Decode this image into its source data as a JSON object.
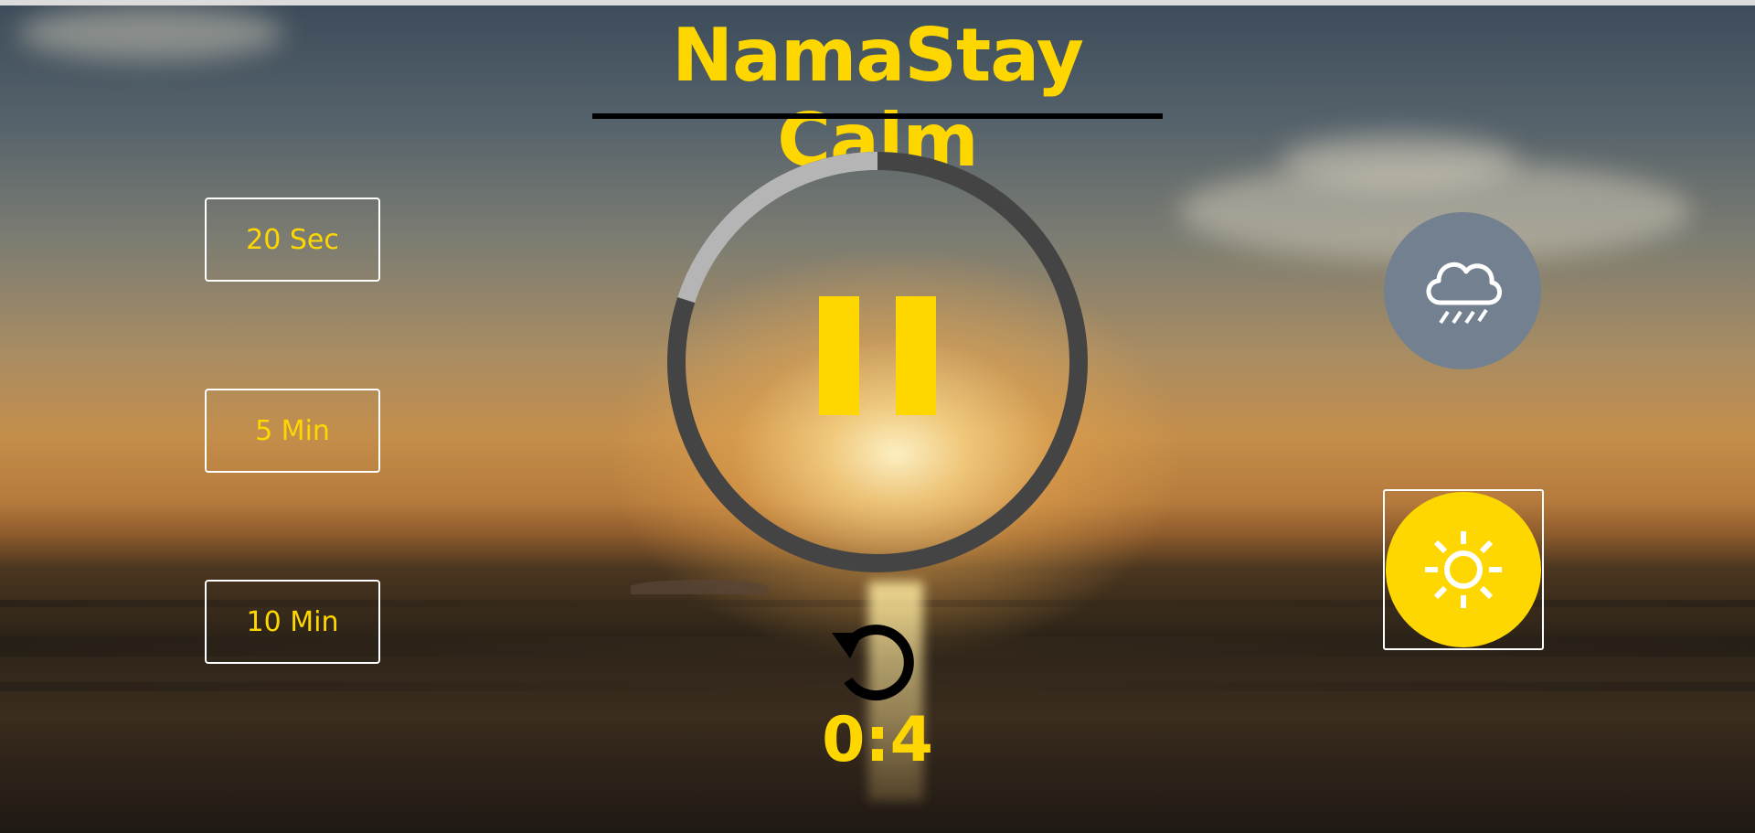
{
  "app": {
    "title": "NamaStay Calm"
  },
  "durations": [
    {
      "label": "20 Sec"
    },
    {
      "label": "5 Min"
    },
    {
      "label": "10 Min"
    }
  ],
  "player": {
    "state": "playing",
    "progress_fraction": 0.2,
    "timer_display": "0:4"
  },
  "sounds": [
    {
      "name": "rain",
      "icon": "cloud-rain-icon",
      "active": false
    },
    {
      "name": "sun",
      "icon": "sun-icon",
      "active": true
    }
  ],
  "colors": {
    "accent": "#ffd700",
    "ring_track": "#444444",
    "ring_progress": "#b5b5b5",
    "rain_button": "#72808f",
    "title_underline": "#000000"
  },
  "icons": {
    "pause": "pause-icon",
    "reset": "reset-icon"
  }
}
